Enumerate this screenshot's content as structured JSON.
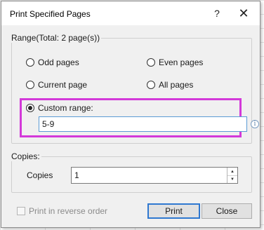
{
  "dialog": {
    "title": "Print Specified Pages",
    "help_symbol": "?",
    "close_symbol": "✕"
  },
  "range": {
    "group_label": "Range(Total: 2 page(s))",
    "options": {
      "odd": "Odd pages",
      "even": "Even pages",
      "current": "Current page",
      "all": "All pages",
      "custom": "Custom range:"
    },
    "selected": "custom",
    "custom_value": "5-9",
    "info_symbol": "i"
  },
  "copies": {
    "group_label": "Copies:",
    "label": "Copies",
    "value": "1"
  },
  "footer": {
    "reverse_label": "Print in reverse order",
    "reverse_checked": false,
    "print_button": "Print",
    "close_button": "Close"
  },
  "colors": {
    "highlight": "#d339d9",
    "focus_blue": "#2f78d0",
    "dialog_bg": "#f0f0f0"
  },
  "icons": {
    "help": "help-icon",
    "close": "close-icon",
    "info": "info-icon",
    "spin_up": "chevron-up-icon",
    "spin_down": "chevron-down-icon"
  }
}
